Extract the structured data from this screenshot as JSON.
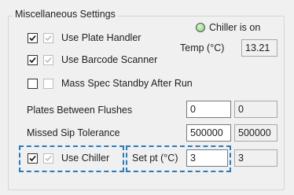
{
  "group": {
    "title": "Miscellaneous Settings"
  },
  "chiller_status": {
    "label": "Chiller is on",
    "color": "#7ccf6c"
  },
  "temp": {
    "label": "Temp (°C)",
    "value": "13.21"
  },
  "options": {
    "use_plate_handler": {
      "label": "Use Plate Handler",
      "checked": true
    },
    "use_barcode_scanner": {
      "label": "Use Barcode Scanner",
      "checked": true
    },
    "mass_spec_standby": {
      "label": "Mass Spec Standby After Run",
      "checked": false
    },
    "use_chiller": {
      "label": "Use Chiller",
      "checked": true
    }
  },
  "plates_between_flushes": {
    "label": "Plates Between Flushes",
    "value": "0",
    "current": "0"
  },
  "missed_sip_tolerance": {
    "label": "Missed Sip Tolerance",
    "value": "500000",
    "current": "500000"
  },
  "set_point": {
    "label": "Set pt (°C)",
    "value": "3",
    "current": "3"
  },
  "colors": {
    "highlight_dash": "#2b7bb9",
    "led_green": "#7ccf6c"
  }
}
